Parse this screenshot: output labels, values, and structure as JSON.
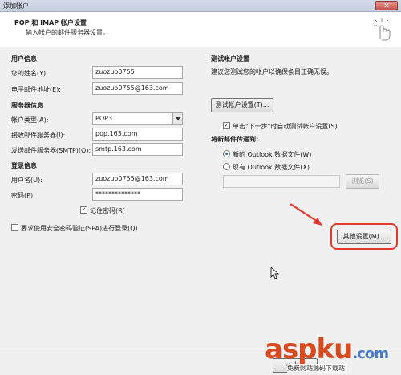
{
  "window": {
    "title": "添加帐户",
    "close_glyph": "✕"
  },
  "header": {
    "title": "POP 和 IMAP 帐户设置",
    "subtitle": "输入帐户的邮件服务器设置。"
  },
  "user_info": {
    "heading": "用户信息",
    "name_label": "您的姓名(Y):",
    "name_value": "zuozuo0755",
    "email_label": "电子邮件地址(E):",
    "email_value": "zuozuo0755@163.com"
  },
  "server_info": {
    "heading": "服务器信息",
    "type_label": "帐户类型(A):",
    "type_value": "POP3",
    "incoming_label": "接收邮件服务器(I):",
    "incoming_value": "pop.163.com",
    "outgoing_label": "发送邮件服务器(SMTP)(O):",
    "outgoing_value": "smtp.163.com"
  },
  "login_info": {
    "heading": "登录信息",
    "username_label": "用户名(U):",
    "username_value": "zuozuo0755@163.com",
    "password_label": "密码(P):",
    "password_value": "**************",
    "remember_label": "记住密码(R)",
    "spa_label": "要求使用安全密码验证(SPA)进行登录(Q)"
  },
  "test_settings": {
    "heading": "测试帐户设置",
    "description": "建议您测试您的帐户以确保条目正确无误。",
    "test_button": "测试帐户设置(T)...",
    "auto_test_label": "单击\"下一步\"时自动测试帐户设置(S)"
  },
  "delivery": {
    "heading": "将新邮件传递到:",
    "new_file_label": "新的 Outlook 数据文件(W)",
    "existing_file_label": "现有 Outlook 数据文件(X)",
    "browse_button": "浏览(S)"
  },
  "more_settings_button": "其他设置(M)...",
  "back_button": "< 上一",
  "watermark": {
    "brand": "aspku",
    "brand_suffix": ".com",
    "tagline": "免费网站源码下载站!"
  },
  "colors": {
    "highlight": "#e23b2e",
    "watermark_main": "#d94a1e",
    "watermark_suffix": "#4a7bc4"
  }
}
